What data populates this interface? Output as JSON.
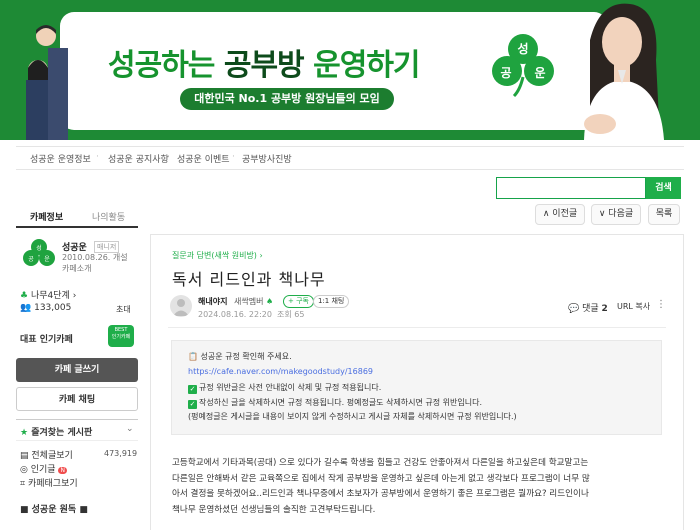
{
  "banner": {
    "title_part1": "성공하는",
    "title_part2": "공부방",
    "title_part3": "운영하기",
    "subtitle": "대한민국 No.1 공부방 원장님들의 모임",
    "clover_chars": [
      "성",
      "공",
      "운"
    ]
  },
  "nav": [
    "성공운 운영정보",
    "성공운 공지사항",
    "성공운 이벤트",
    "공부방사진방"
  ],
  "search": {
    "button": "검색"
  },
  "post_nav": {
    "prev": "이전글",
    "next": "다음글",
    "list": "목록"
  },
  "sidebar": {
    "tabs": [
      "카페정보",
      "나의활동"
    ],
    "cafe_logo_chars": [
      "성",
      "공",
      "운"
    ],
    "cafe_name": "성공운",
    "cafe_badge": "매니저",
    "cafe_date": "2010.08.26. 개설",
    "cafe_intro": "카페소개",
    "level": "나무4단계",
    "members": "133,005",
    "invite": "초대",
    "pop_label": "대표 인기카페",
    "pop_badge": [
      "BEST",
      "인기카페"
    ],
    "write_button": "카페 글쓰기",
    "chat_button": "카페 채팅",
    "fav_boards": "즐겨찾는 게시판",
    "all_posts": "전체글보기",
    "all_count": "473,919",
    "popular": "인기글",
    "tag": "카페태그보기",
    "menu_head": "성공운 원독"
  },
  "post": {
    "breadcrumb": "질문과 답변(새싹 원비방)",
    "title": "독서 리드인과 책나무",
    "author": "해내야지",
    "grade": "새싹멤버",
    "follow": "+ 구독",
    "chat": "1:1 채팅",
    "date": "2024.08.16. 22:20",
    "views": "조회 65",
    "comments_label": "댓글",
    "comments_count": "2",
    "url_copy": "URL 복사",
    "notice": {
      "title": "성공운 규정 확인해 주세요.",
      "link": "https://cafe.naver.com/makegoodstudy/16869",
      "line1": "규정 위반글은 사전 안내없이 삭제 및 규정 적용됩니다.",
      "line2": "작성하신 글을 삭제하시면 규정 적용됩니다. 펑예정글도 삭제하시면 규정 위반입니다.",
      "line3": "(펑예정글은 게시글을 내용이 보이지 않게 수정하시고 게시글 자체를 삭제하시면 규정 위반입니다.)"
    },
    "body": [
      "고등학교에서 기타과목(공대) 으로 있다가 길수록 학생을 힘들고 건강도 안좋아져서 다른일을 하고싶은데 학교말고는",
      "다른일은 안해봐서 같은 교육쪽으로 집에서 작게 공부방을 운영하고 싶은데 아는게 없고 생각보다 프로그램이 너무 많",
      "아서 결정을 못하겠어요..리드인과 책나무중에서 초보자가 공부방에서 운영하기 좋은 프로그램은 뭘까요? 리드인이나",
      "책나무 운영하셨던 선생님들의 솔직한 고견부탁드립니다."
    ]
  }
}
